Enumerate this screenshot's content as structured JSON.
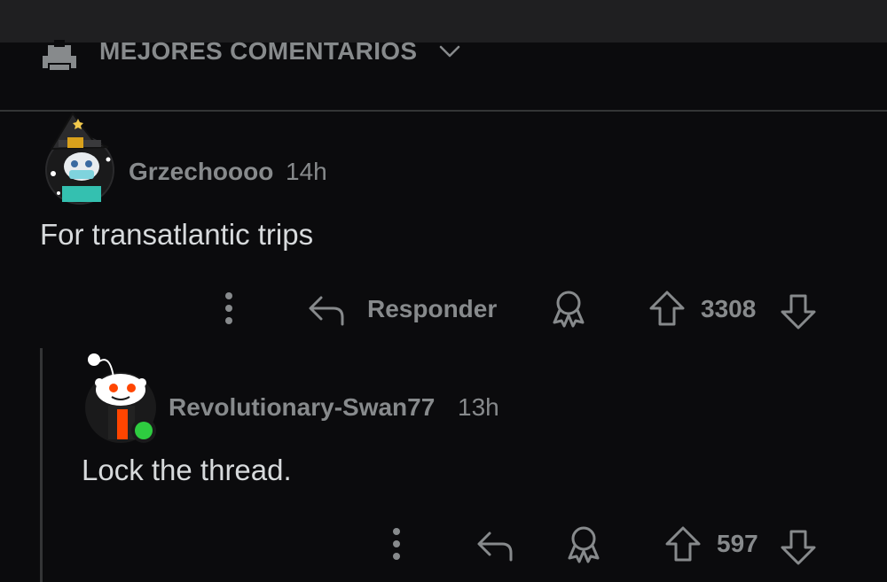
{
  "sort": {
    "label": "MEJORES COMENTARIOS",
    "icon": "rocket-icon"
  },
  "comments": [
    {
      "username": "Grzechoooo",
      "time": "14h",
      "text": "For transatlantic trips",
      "reply_label": "Responder",
      "votes": "3308"
    },
    {
      "username": "Revolutionary-Swan77",
      "time": "13h",
      "text": "Lock the thread.",
      "votes": "597"
    }
  ],
  "colors": {
    "background": "#0b0b0d",
    "muted": "#878a8c",
    "text": "#d7dadc",
    "divider": "#343536"
  }
}
